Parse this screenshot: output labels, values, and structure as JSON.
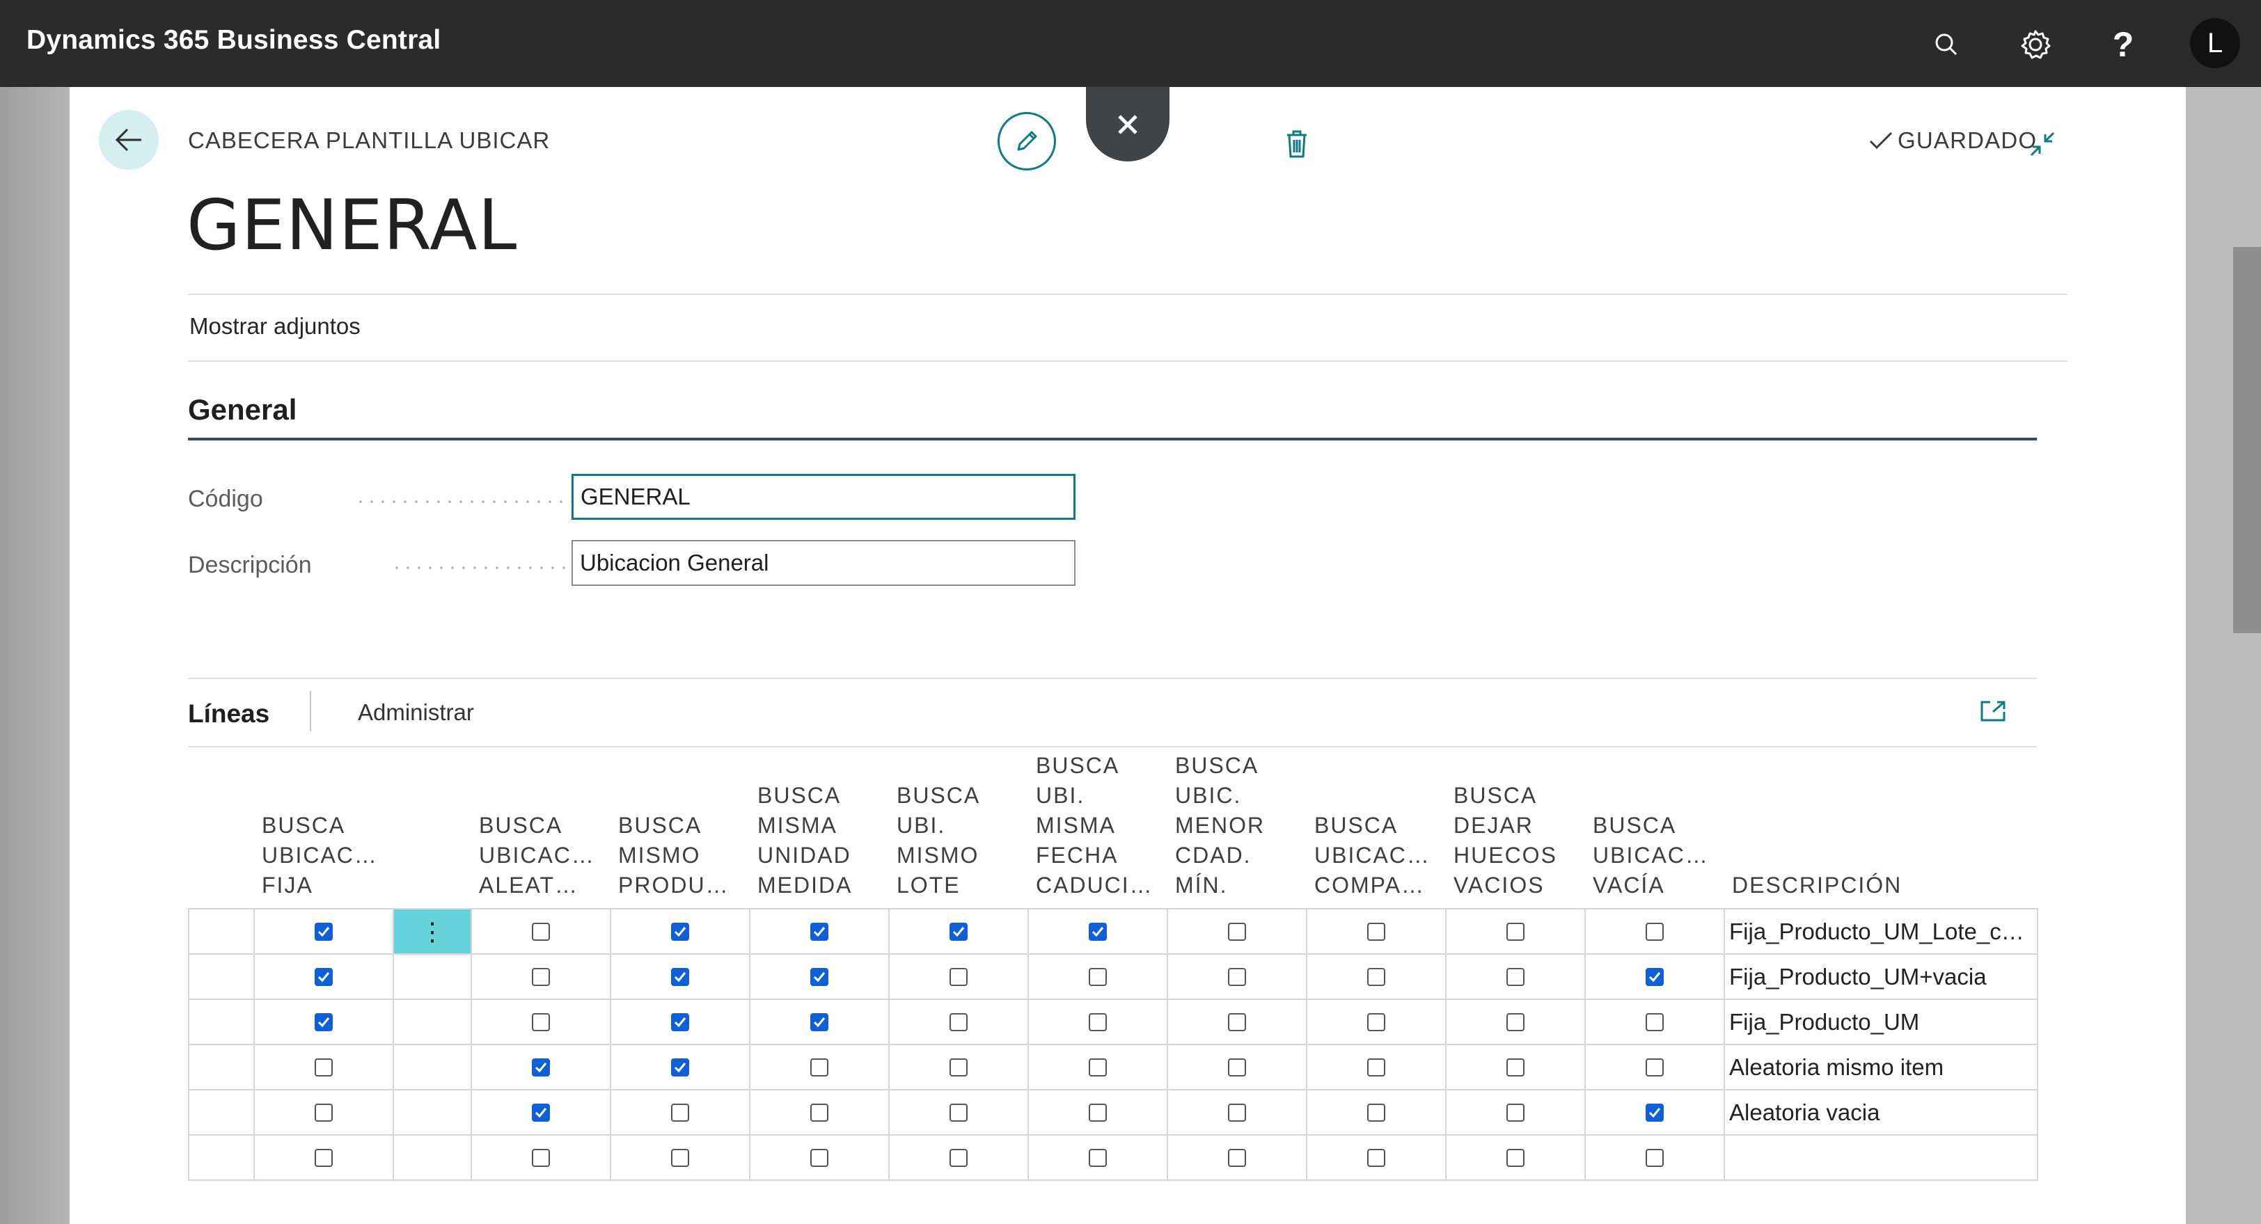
{
  "app": {
    "title": "Dynamics 365 Business Central",
    "user_initial": "L"
  },
  "header": {
    "kicker": "CABECERA PLANTILLA UBICAR",
    "title": "GENERAL",
    "saved_label": "GUARDADO"
  },
  "actions": {
    "attachments": "Mostrar adjuntos"
  },
  "section": {
    "title": "General",
    "fields": [
      {
        "label": "Código",
        "value": "GENERAL"
      },
      {
        "label": "Descripción",
        "value": "Ubicacion General"
      }
    ]
  },
  "lines": {
    "title": "Líneas",
    "manage": "Administrar",
    "headers": [
      "BUSCA\nUBICAC…\nFIJA",
      "",
      "BUSCA\nUBICAC…\nALEAT…",
      "BUSCA\nMISMO\nPRODU…",
      "BUSCA\nMISMA\nUNIDAD\nMEDIDA",
      "BUSCA\nUBI.\nMISMO\nLOTE",
      "BUSCA\nUBI.\nMISMA\nFECHA\nCADUCI…",
      "BUSCA\nUBIC.\nMENOR\nCDAD.\nMÍN.",
      "BUSCA\nUBICAC…\nCOMPA…",
      "BUSCA\nDEJAR\nHUECOS\nVACIOS",
      "BUSCA\nUBICAC…\nVACÍA",
      "DESCRIPCIÓN"
    ],
    "rows": [
      {
        "checks": [
          true,
          false,
          true,
          true,
          true,
          true,
          false,
          false,
          false,
          false
        ],
        "description": "Fija_Producto_UM_Lote_c…"
      },
      {
        "checks": [
          true,
          false,
          true,
          true,
          false,
          false,
          false,
          false,
          false,
          true
        ],
        "description": "Fija_Producto_UM+vacia"
      },
      {
        "checks": [
          true,
          false,
          true,
          true,
          false,
          false,
          false,
          false,
          false,
          false
        ],
        "description": "Fija_Producto_UM"
      },
      {
        "checks": [
          false,
          true,
          true,
          false,
          false,
          false,
          false,
          false,
          false,
          false
        ],
        "description": "Aleatoria mismo item"
      },
      {
        "checks": [
          false,
          true,
          false,
          false,
          false,
          false,
          false,
          false,
          false,
          true
        ],
        "description": "Aleatoria vacia"
      },
      {
        "checks": [
          false,
          false,
          false,
          false,
          false,
          false,
          false,
          false,
          false,
          false
        ],
        "description": ""
      }
    ]
  },
  "colors": {
    "accent": "#0f7b82",
    "checkbox": "#0f5fd6",
    "selected_cell": "#66d3dc",
    "topbar": "#2b2b2b"
  },
  "icons": [
    "search-icon",
    "gear-icon",
    "help-icon",
    "back-arrow-icon",
    "pencil-icon",
    "close-icon",
    "trash-icon",
    "checkmark-icon",
    "collapse-icon",
    "expand-icon",
    "more-vertical-icon"
  ]
}
